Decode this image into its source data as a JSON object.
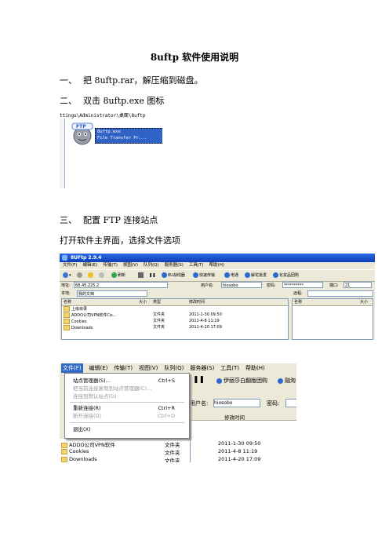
{
  "title": "8uftp 软件使用说明",
  "steps": [
    {
      "num": "一、",
      "text": "把 8uftp.rar，解压缩到磁盘。"
    },
    {
      "num": "二、",
      "text": "双击 8uftp.exe 图标"
    },
    {
      "num": "三、",
      "text": "配置 FTP 连接站点"
    }
  ],
  "paragraph": "打开软件主界面，选择文件选项",
  "shot1": {
    "path": "ttings\\Administrator\\桌面\\8uftp",
    "icon_label": "FTP",
    "file_line1": "8uftp.exe",
    "file_line2": "File Transfer Pr..."
  },
  "shot2": {
    "window_title": "8UFtp 2.9.4",
    "menu": [
      "文件(F)",
      "编辑(E)",
      "传输(T)",
      "视图(V)",
      "队列(Q)",
      "服务器(S)",
      "工具(T)",
      "帮助(H)"
    ],
    "toolbar": [
      "刷新",
      "8U战线器",
      "快速传输",
      "电通",
      "解花批发",
      "化妆品团购"
    ],
    "addr_label": "地址:",
    "addr_value": "68.45.225.2",
    "user_label": "用户名:",
    "user_value": "hiosobo",
    "pass_label": "密码:",
    "pass_value": "**********",
    "port_label": "端口:",
    "port_value": "21",
    "local_label": "本地:",
    "local_value": "我的文档",
    "remote_label": "远程:",
    "local_columns": [
      "名称",
      "大小",
      "类型",
      "修改时间"
    ],
    "remote_columns": [
      "名称",
      "大小"
    ],
    "rows": [
      {
        "name": "上级目录",
        "size": "",
        "type": "",
        "date": ""
      },
      {
        "name": "ADDO公司VPN软件Cis...",
        "size": "",
        "type": "文件夹",
        "date": "2011-1-30 09:50"
      },
      {
        "name": "Cookies",
        "size": "",
        "type": "文件夹",
        "date": "2011-4-8 11:19"
      },
      {
        "name": "Downloads",
        "size": "",
        "type": "文件夹",
        "date": "2011-4-20 17:09"
      }
    ]
  },
  "shot3": {
    "menu": [
      "文件(F)",
      "编辑(E)",
      "传输(T)",
      "视图(V)",
      "队列(Q)",
      "服务器(S)",
      "工具(T)",
      "帮助(H)"
    ],
    "items": [
      {
        "label": "站点管理器(S)...",
        "shortcut": "Ctrl+S",
        "disabled": false
      },
      {
        "label": "把当前连接复制到站点管理器(C)...",
        "shortcut": "",
        "disabled": true
      },
      {
        "label": "连接到默认站点(D)",
        "shortcut": "",
        "disabled": true
      },
      {
        "label": "重新连接(R)",
        "shortcut": "Ctrl+R",
        "disabled": false
      },
      {
        "label": "断开连接(D)",
        "shortcut": "Ctrl+D",
        "disabled": true
      },
      {
        "label": "退出(X)",
        "shortcut": "",
        "disabled": false
      }
    ],
    "toolbar_text1": "伊丽莎白翻版团购",
    "toolbar_text2": "融淘",
    "user_label": "用户名:",
    "user_value": "hiosobo",
    "pass_label": "密码:",
    "col_date": "修改时间",
    "rows": [
      {
        "name": "ADDO公司VPN软件",
        "type": "文件夹",
        "date": "2011-1-30 09:50"
      },
      {
        "name": "Cookies",
        "type": "文件夹",
        "date": "2011-4-8 11:19"
      },
      {
        "name": "Downloads",
        "type": "文件夹",
        "date": "2011-4-20 17:09"
      }
    ]
  }
}
